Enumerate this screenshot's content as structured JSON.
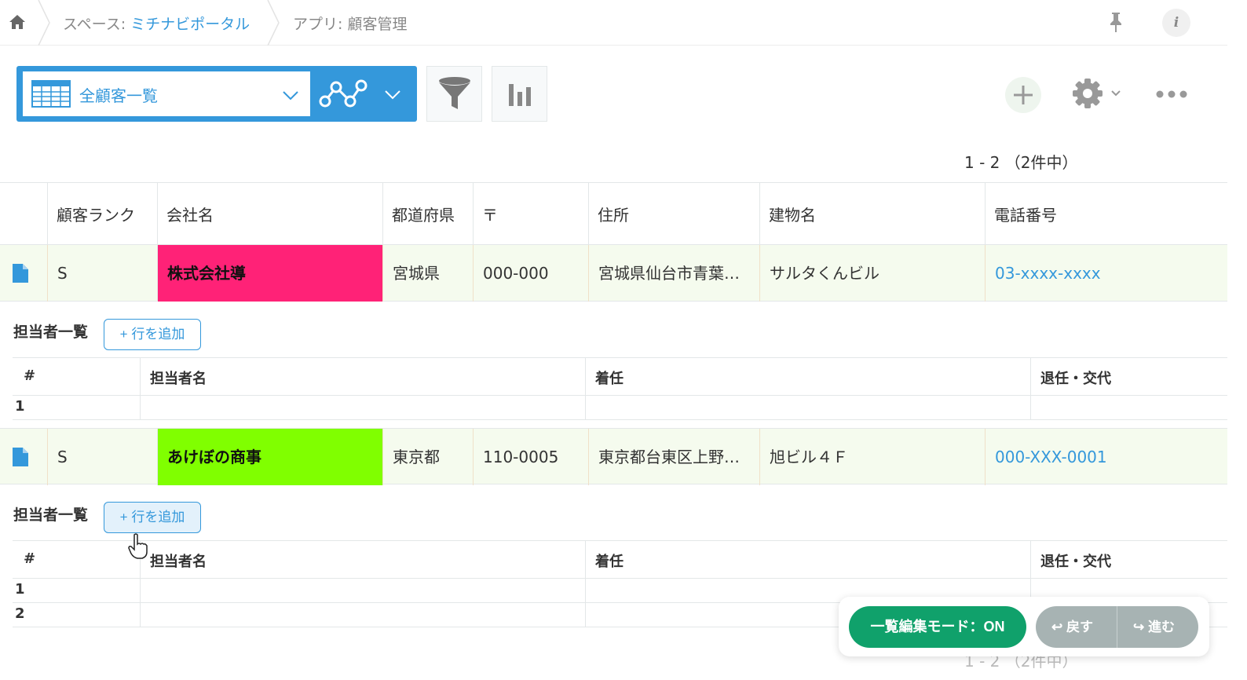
{
  "breadcrumb": {
    "space_prefix": "スペース: ",
    "space_name": "ミチナビポータル",
    "app_label": "アプリ: 顧客管理"
  },
  "toolbar": {
    "view_name": "全顧客一覧"
  },
  "pager": {
    "top": "1 - 2 （2件中）",
    "bottom": "1 - 2 （2件中）"
  },
  "table": {
    "headers": [
      "顧客ランク",
      "会社名",
      "都道府県",
      "〒",
      "住所",
      "建物名",
      "電話番号"
    ],
    "rows": [
      {
        "rank": "S",
        "company": "株式会社導",
        "company_color": "#ff2277",
        "prefecture": "宮城県",
        "zip": "000-000",
        "address": "宮城県仙台市青葉…",
        "building": "サルタくんビル",
        "phone": "03-xxxx-xxxx"
      },
      {
        "rank": "S",
        "company": "あけぼの商事",
        "company_color": "#80ff00",
        "prefecture": "東京都",
        "zip": "110-0005",
        "address": "東京都台東区上野…",
        "building": "旭ビル４Ｆ",
        "phone": "000-XXX-0001"
      }
    ]
  },
  "subtable": {
    "title": "担当者一覧",
    "add_row_label": "+ 行を追加",
    "headers": [
      "#",
      "担当者名",
      "着任",
      "退任・交代"
    ],
    "row1_numbers": [
      "1"
    ],
    "row2_numbers": [
      "1",
      "2"
    ]
  },
  "float": {
    "edit_mode_label": "一覧編集モード：ON",
    "undo_label": "↩ 戻す",
    "redo_label": "↪ 進む"
  },
  "colors": {
    "accent": "#3498db",
    "edit_mode": "#10a16b",
    "row_bg": "#f5fbee"
  }
}
